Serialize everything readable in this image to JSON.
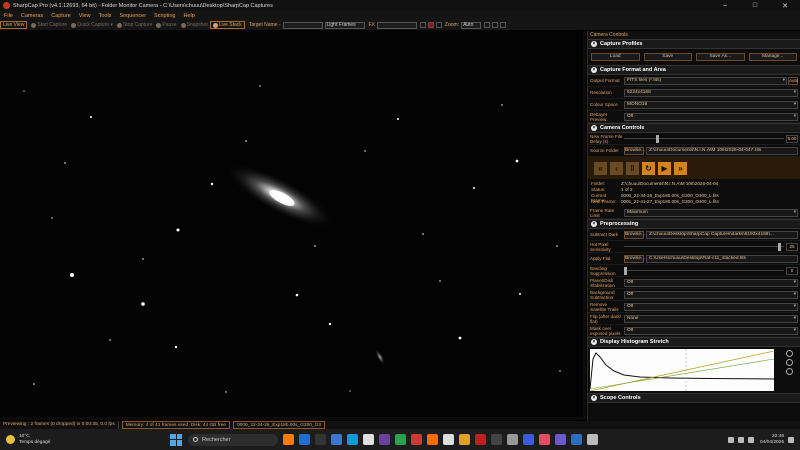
{
  "window": {
    "title": "SharpCap Pro (v4.1.12693, 64 bit) - Folder Monitor Camera - C:\\Users\\chuuu\\Desktop\\SharpCap Captures",
    "controls": [
      "–",
      "□",
      "✕"
    ]
  },
  "menu": [
    "File",
    "Cameras",
    "Capture",
    "View",
    "Tools",
    "Sequencer",
    "Scripting",
    "Help"
  ],
  "toolbar": {
    "live_view": "Live View",
    "start_capture": "Start Capture",
    "quick_capture": "Quick Capture",
    "stop_capture": "Stop Capture",
    "pause": "Pause",
    "snapshot": "Snapshot",
    "live_stack": "Live Stack",
    "target_name_label": "Target Name -",
    "target_name_value": "",
    "frame_type": "Light Frames",
    "fx_label": "FX",
    "fx_value": "",
    "zoom_label": "Zoom:",
    "zoom_value": "Auto"
  },
  "panel": {
    "title": "Camera Controls",
    "capture_profiles": {
      "header": "Capture Profiles",
      "load": "Load",
      "save": "Save",
      "save_as": "Save As...",
      "manage": "Manage..."
    },
    "format": {
      "header": "Capture Format and Area",
      "output_format_label": "Output Format",
      "output_format_value": "FITS files (*.fits)",
      "auto": "Auto",
      "resolution_label": "Resolution",
      "resolution_value": "6224x4168",
      "colour_space_label": "Colour Space",
      "colour_space_value": "MONO16",
      "debayer_label": "Debayer Preview",
      "debayer_value": "Off"
    },
    "camera": {
      "header": "Camera Controls",
      "new_frame_label": "New Frame File Delay (s)",
      "new_frame_value": "5.00",
      "source_folder_label": "Source Folder",
      "browse": "Browse...",
      "source_folder_value": "Z:\\chuuu\\Documents\\N.I.N.A\\M 106\\2026-04-04\\*.fits",
      "info": [
        {
          "k": "Folder:",
          "v": "Z:\\chuuu\\Documents\\N.I.N.A\\M 106\\2026-04-04"
        },
        {
          "k": "Status:",
          "v": "1 of 2"
        },
        {
          "k": "Current Frame:",
          "v": "0000_22-34-26_Exp180.00s_G300_O300_L.fits"
        },
        {
          "k": "Next Frame:",
          "v": "0001_22-41-27_Exp180.00s_G300_O300_L.fits"
        }
      ],
      "frame_rate_label": "Frame Rate Limit",
      "frame_rate_value": "Maximum"
    },
    "preprocessing": {
      "header": "Preprocessing",
      "subtract_dark_label": "Subtract Dark",
      "subtract_dark_browse": "Browse...",
      "subtract_dark_value": "Z:\\chuuu\\Desktop\\SharpCap Captures\\darks\\6192x4168\\...",
      "hot_pixel_label": "Hot Pixel Sensitivity",
      "hot_pixel_value": "25",
      "apply_flat_label": "Apply Flat",
      "apply_flat_browse": "Browse...",
      "apply_flat_value": "C:\\Users\\chuuu\\Desktop\\Flat-c11_stacked.fits",
      "banding_label": "Banding Suppression",
      "banding_value": "0",
      "planet_disk_label": "Planet/Disk Stabilization",
      "planet_disk_value": "Off",
      "bg_sub_label": "Background Subtraction",
      "bg_sub_value": "Off",
      "satellite_label": "Remove Satellite Trails",
      "satellite_value": "Off",
      "flip_label": "Flip (after dark/ flat)",
      "flip_value": "None",
      "mask_label": "Mask over exposed pixels",
      "mask_value": "Off"
    },
    "histogram_header": "Display Histogram Stretch",
    "scope_header": "Scope Controls"
  },
  "status": {
    "previewing": "Previewing : 2 frames (0 dropped) in 0:00:35, 0.0 fps",
    "memory": "Memory: 4 of 41 frames used. Disk: 44 GB free",
    "current_file": "0000_22-34-26_Exp180.00s_G300_O3"
  },
  "taskbar": {
    "temperature": "10°C",
    "weather": "Temps dégagé",
    "search_placeholder": "Rechercher",
    "time": "22:46",
    "date": "04/04/2026"
  }
}
